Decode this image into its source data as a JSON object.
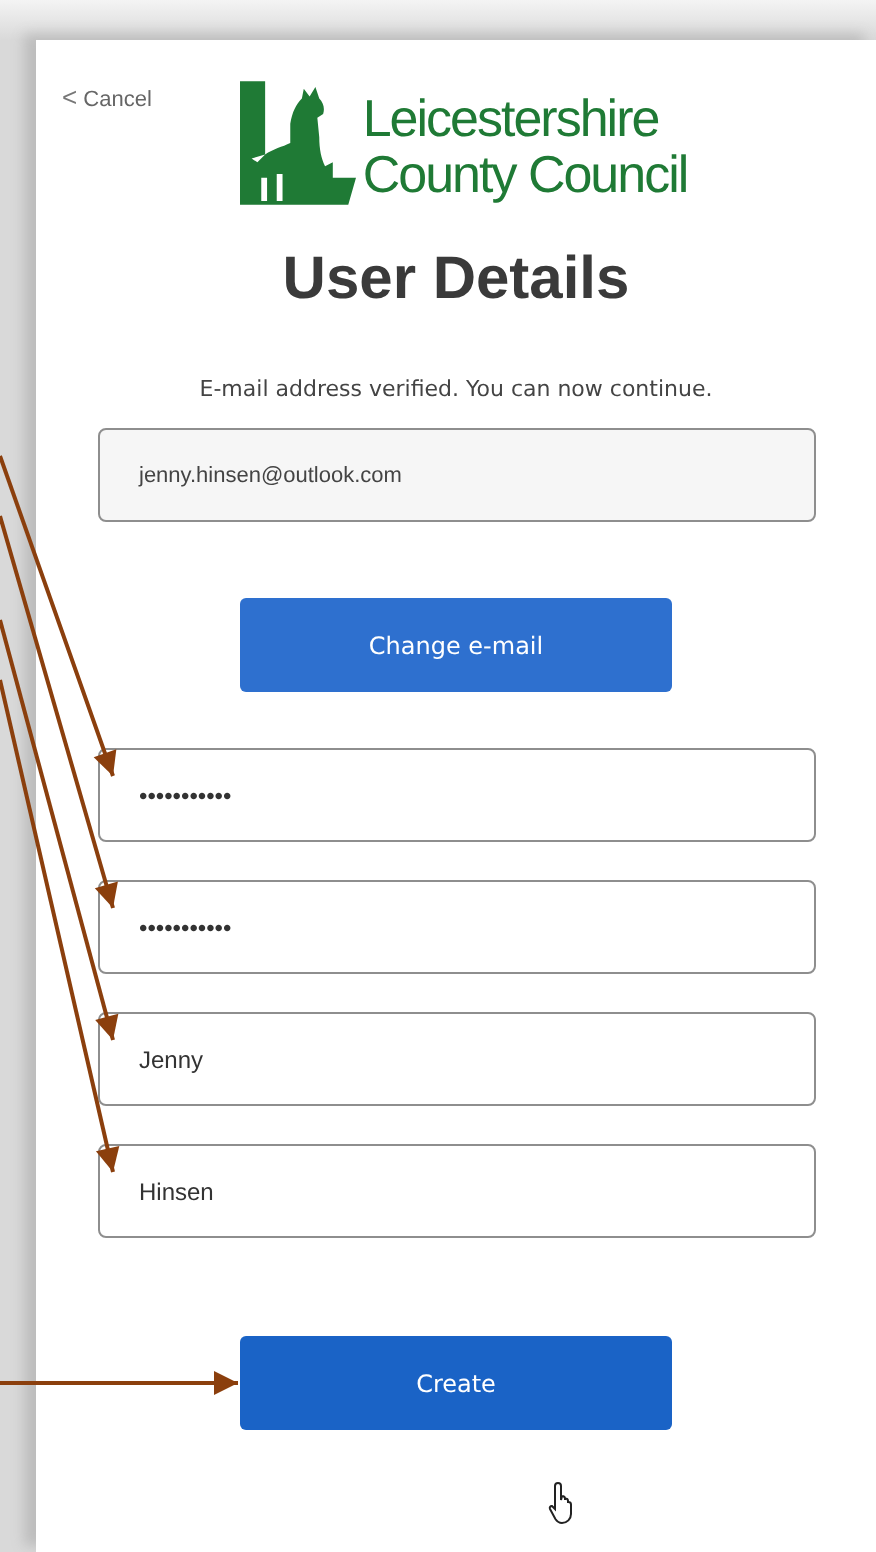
{
  "cancel": {
    "icon": "<",
    "label": "Cancel"
  },
  "logo": {
    "line_1": "Leicestershire",
    "line_2": "County Council"
  },
  "title": "User Details",
  "message": "E-mail address verified. You can now continue.",
  "fields": [
    {
      "kind": "readonly",
      "value": "jenny.hinsen@outlook.com"
    },
    {
      "kind": "button",
      "label": "Change e-mail"
    },
    {
      "kind": "input",
      "value": "•••••••••••",
      "annotated": true
    },
    {
      "kind": "input",
      "value": "•••••••••••",
      "annotated": true
    },
    {
      "kind": "input",
      "value": "Jenny",
      "annotated": true
    },
    {
      "kind": "input",
      "value": "Hinsen",
      "annotated": true
    },
    {
      "kind": "submit",
      "label": "Create",
      "annotated": true
    }
  ]
}
